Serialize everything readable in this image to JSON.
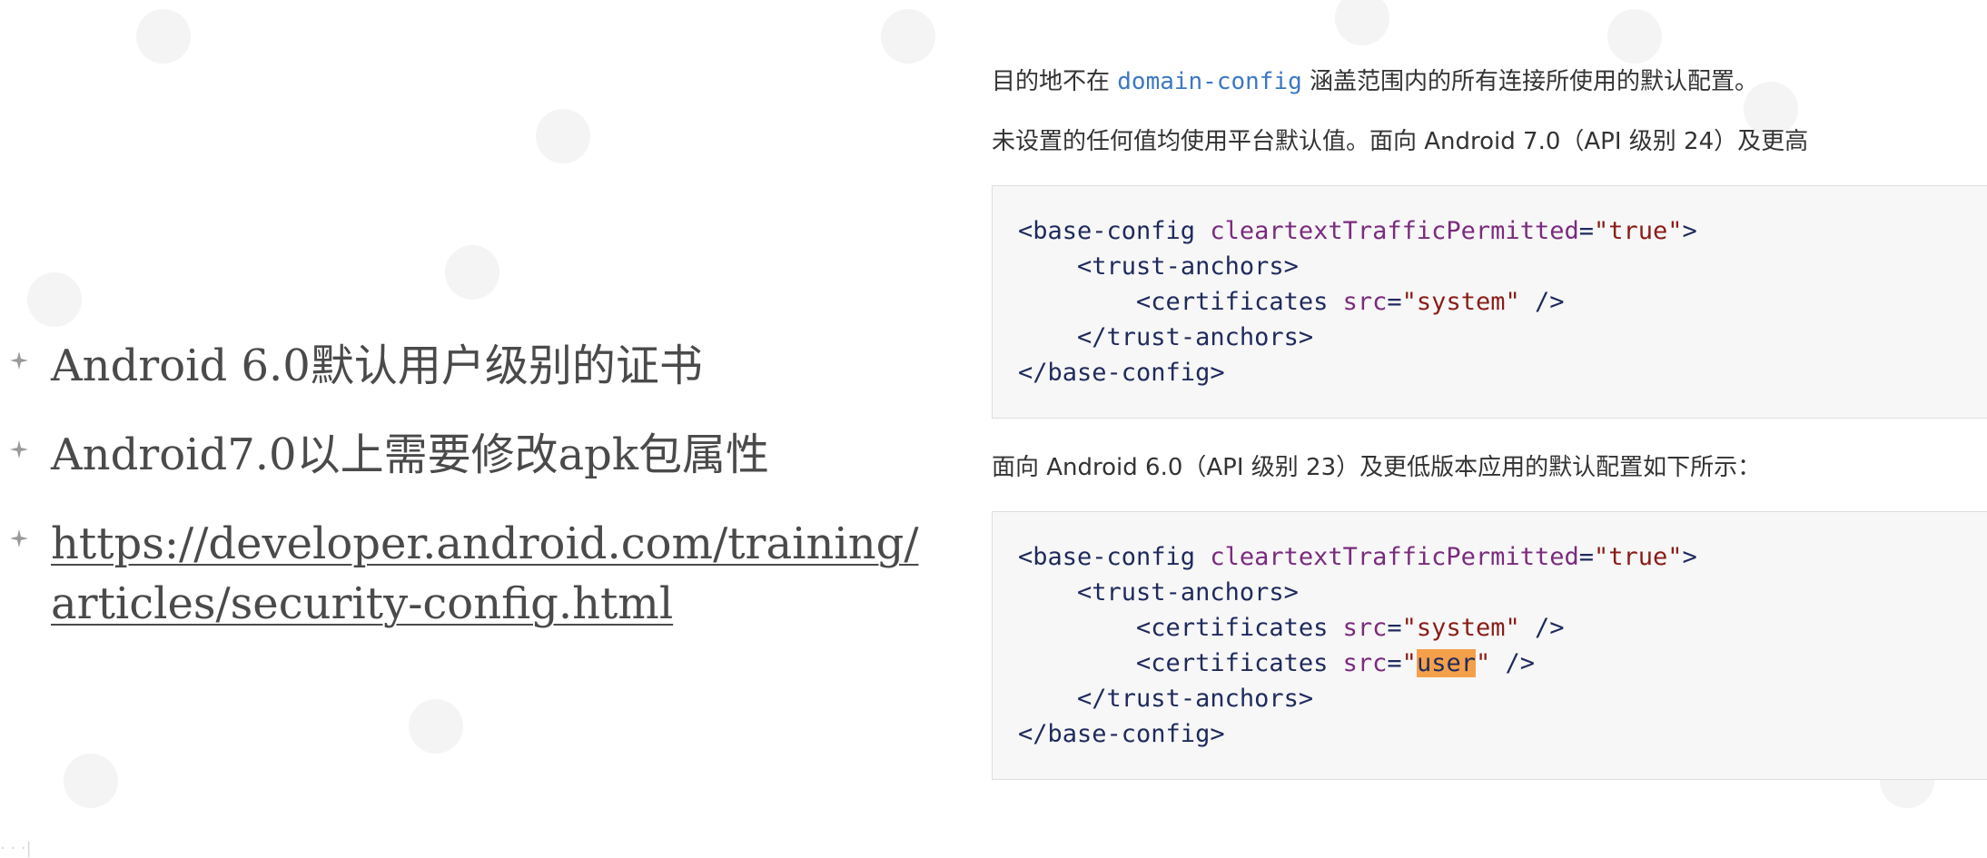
{
  "bullets": [
    {
      "text": "Android 6.0默认用户级别的证书",
      "is_link": false
    },
    {
      "text": "Android7.0以上需要修改apk包属性",
      "is_link": false
    },
    {
      "text": "https://developer.android.com/training/articles/security-config.html",
      "line1": "https://developer.android.com/training/",
      "line2": "articles/security-config.html",
      "is_link": true
    }
  ],
  "doc": {
    "para1_before": "目的地不在 ",
    "para1_code": "domain-config",
    "para1_after": " 涵盖范围内的所有连接所使用的默认配置。",
    "para2": "未设置的任何值均使用平台默认值。面向 Android 7.0（API 级别 24）及更高",
    "para3": "面向 Android 6.0（API 级别 23）及更低版本应用的默认配置如下所示：",
    "code1": {
      "l1_tag": "<base-config ",
      "l1_attr": "cleartextTrafficPermitted",
      "l1_eq": "=",
      "l1_str": "\"true\"",
      "l1_close": ">",
      "l2": "<trust-anchors>",
      "l3_tag": "<certificates ",
      "l3_attr": "src",
      "l3_eq": "=",
      "l3_str": "\"system\"",
      "l3_close": " />",
      "l4": "</trust-anchors>",
      "l5": "</base-config>"
    },
    "code2": {
      "l1_tag": "<base-config ",
      "l1_attr": "cleartextTrafficPermitted",
      "l1_eq": "=",
      "l1_str": "\"true\"",
      "l1_close": ">",
      "l2": "<trust-anchors>",
      "l3_tag": "<certificates ",
      "l3_attr": "src",
      "l3_eq": "=",
      "l3_str": "\"system\"",
      "l3_close": " />",
      "l4_tag": "<certificates ",
      "l4_attr": "src",
      "l4_eq": "=",
      "l4_q1": "\"",
      "l4_hl": "user",
      "l4_q2": "\"",
      "l4_close": " />",
      "l5": "</trust-anchors>",
      "l6": "</base-config>"
    }
  },
  "corner_text": "· · ·|",
  "colors": {
    "text": "#4a4a4a",
    "code_bg": "#f7f7f7",
    "tag": "#1f2a5c",
    "attr": "#7a2b7d",
    "string": "#8a1c17",
    "highlight": "#f4a04a",
    "inline_code": "#3b78c4"
  }
}
